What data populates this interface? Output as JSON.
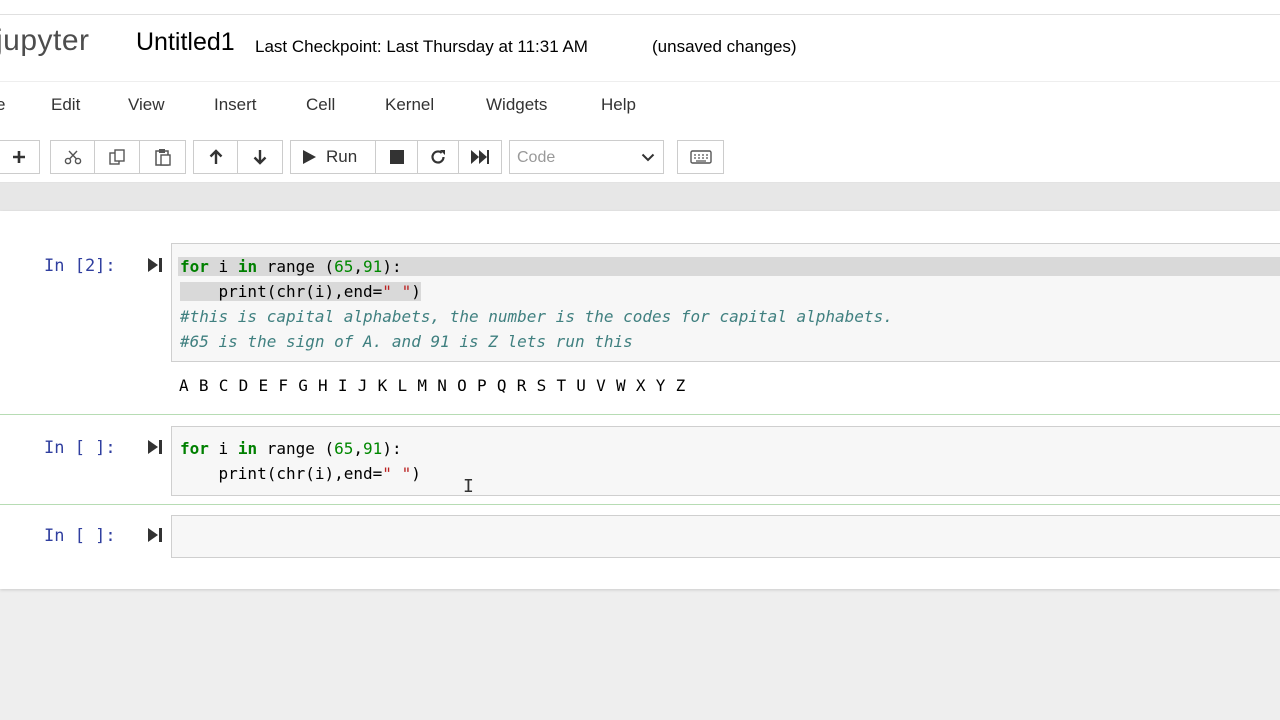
{
  "header": {
    "logo": "jupyter",
    "notebook_name": "Untitled1",
    "checkpoint": "Last Checkpoint: Last Thursday at 11:31 AM",
    "status": "(unsaved changes)"
  },
  "menu": {
    "items": [
      {
        "label": "e"
      },
      {
        "label": "Edit"
      },
      {
        "label": "View"
      },
      {
        "label": "Insert"
      },
      {
        "label": "Cell"
      },
      {
        "label": "Kernel"
      },
      {
        "label": "Widgets"
      },
      {
        "label": "Help"
      }
    ]
  },
  "toolbar": {
    "run_label": "Run",
    "cell_type": "Code",
    "icons": [
      "plus-icon",
      "cut-icon",
      "copy-icon",
      "paste-icon",
      "arrow-up-icon",
      "arrow-down-icon",
      "run-icon",
      "stop-icon",
      "restart-icon",
      "fast-forward-icon",
      "chevron-down-icon",
      "keyboard-icon"
    ]
  },
  "cells": [
    {
      "prompt": "In [2]:",
      "lines": [
        {
          "t1": "for",
          "t2": " i ",
          "t3": "in",
          "t4": " range (",
          "t5": "65",
          "t6": ",",
          "t7": "91",
          "t8": "):"
        },
        {
          "t1": "    print(chr(i),end=",
          "t2": "\" \"",
          "t3": ")"
        },
        {
          "comment": "#this is capital alphabets, the number is the codes for capital alphabets."
        },
        {
          "comment": "#65 is the sign of A. and 91 is Z lets run this"
        }
      ],
      "output": "A B C D E F G H I J K L M N O P Q R S T U V W X Y Z"
    },
    {
      "prompt": "In [ ]:",
      "lines": [
        {
          "t1": "for",
          "t2": " i ",
          "t3": "in",
          "t4": " range (",
          "t5": "65",
          "t6": ",",
          "t7": "91",
          "t8": "):"
        },
        {
          "t1": "    print(chr(i),end=",
          "t2": "\" \"",
          "t3": ")"
        }
      ]
    },
    {
      "prompt": "In [ ]:"
    }
  ],
  "colors": {
    "prompt": "#303f9f",
    "keyword": "#008000",
    "string": "#ba2121",
    "comment": "#408080",
    "selected_divider": "#b7dcb4"
  }
}
